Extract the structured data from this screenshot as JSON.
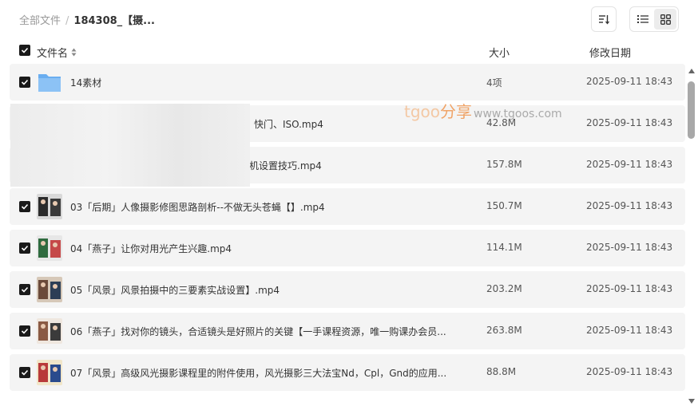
{
  "breadcrumb": {
    "root": "全部文件",
    "separator": "/",
    "current": "184308_【摄..."
  },
  "columns": {
    "name": "文件名",
    "size": "大小",
    "date": "修改日期"
  },
  "icons": {
    "sort": "sort-list-icon",
    "list_view": "list-view-icon",
    "grid_view": "grid-view-icon",
    "checkbox": "checkbox-checked-icon",
    "folder": "folder-icon"
  },
  "colors": {
    "checkbox": "#1a1a1a",
    "folder": "#6aaef0",
    "row_bg": "#f4f4f4"
  },
  "watermark": {
    "brand": "tgoo",
    "brand_cn": "分享",
    "url": "www.tgoos.com"
  },
  "rows": [
    {
      "name": "14素材",
      "size": "4项",
      "date": "2025-09-11 18:43",
      "type": "folder"
    },
    {
      "name": "快门、ISO.mp4",
      "size": "42.8M",
      "date": "2025-09-11 18:43",
      "type": "video"
    },
    {
      "name": "相机设置技巧.mp4",
      "size": "157.8M",
      "date": "2025-09-11 18:43",
      "type": "video"
    },
    {
      "name": "03「后期」人像摄影修图思路剖析--不做无头苍蝇【】.mp4",
      "size": "150.7M",
      "date": "2025-09-11 18:43",
      "type": "video"
    },
    {
      "name": "04「燕子」让你对用光产生兴趣.mp4",
      "size": "114.1M",
      "date": "2025-09-11 18:43",
      "type": "video"
    },
    {
      "name": "05「风景」风景拍摄中的三要素实战设置】.mp4",
      "size": "203.2M",
      "date": "2025-09-11 18:43",
      "type": "video"
    },
    {
      "name": "06「燕子」找对你的镜头，合适镜头是好照片的关键【一手课程资源，唯一购课办会员...",
      "size": "263.8M",
      "date": "2025-09-11 18:43",
      "type": "video"
    },
    {
      "name": "07「风景」高级风光摄影课程里的附件使用，风光摄影三大法宝Nd，Cpl，Gnd的应用...",
      "size": "88.8M",
      "date": "2025-09-11 18:43",
      "type": "video"
    }
  ]
}
